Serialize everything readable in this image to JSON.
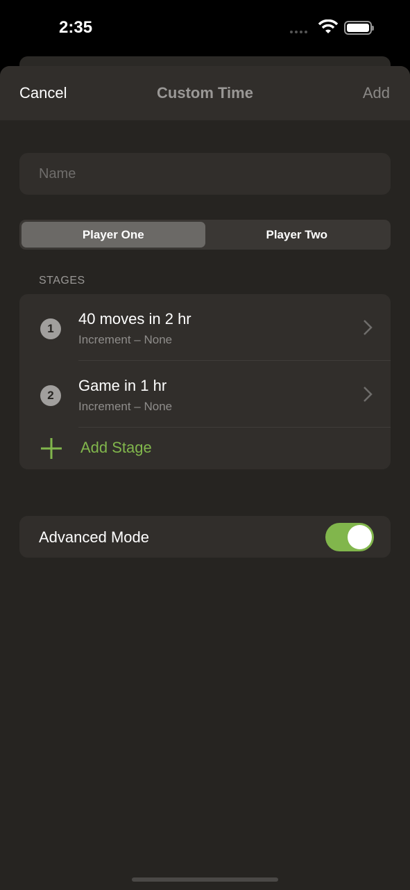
{
  "status_bar": {
    "time": "2:35"
  },
  "nav": {
    "cancel": "Cancel",
    "title": "Custom Time",
    "add": "Add"
  },
  "name_field": {
    "placeholder": "Name",
    "value": ""
  },
  "segments": [
    {
      "label": "Player One",
      "selected": true
    },
    {
      "label": "Player Two",
      "selected": false
    }
  ],
  "stages_header": "STAGES",
  "stages": [
    {
      "number": "1",
      "title": "40 moves in 2 hr",
      "subtitle": "Increment – None"
    },
    {
      "number": "2",
      "title": "Game in 1 hr",
      "subtitle": "Increment – None"
    }
  ],
  "add_stage": "Add Stage",
  "advanced_mode": {
    "label": "Advanced Mode",
    "on": true
  },
  "colors": {
    "accent": "#81b64c",
    "background": "#262421",
    "card": "#312e2b"
  }
}
